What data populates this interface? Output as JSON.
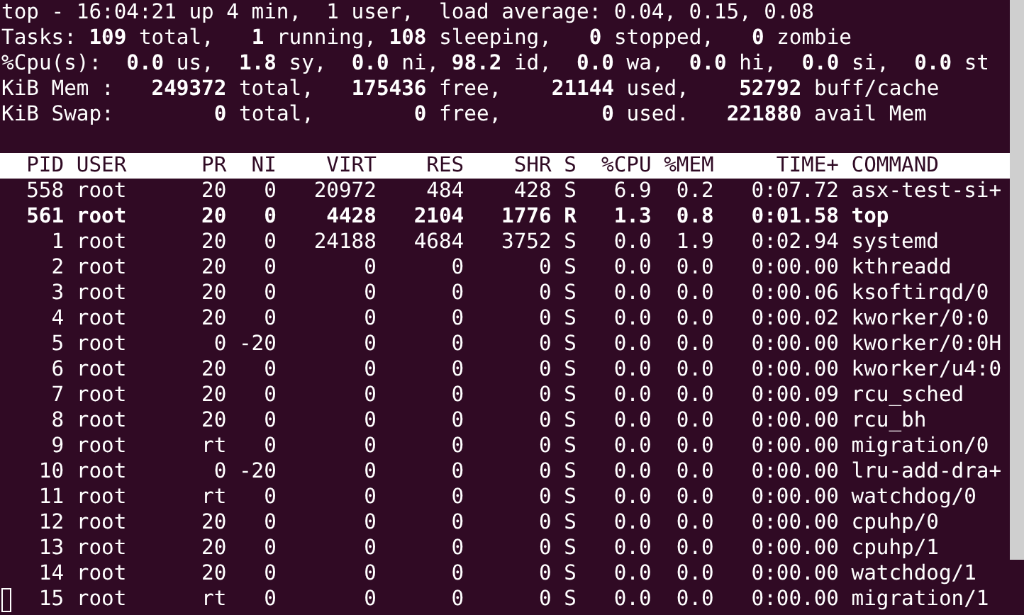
{
  "summary": [
    "top - 16:04:21 up 4 min,  1 user,  load average: 0.04, 0.15, 0.08",
    "Tasks: **109** total,   **1** running, **108** sleeping,   **0** stopped,   **0** zombie",
    "%Cpu(s):  **0.0** us,  **1.8** sy,  **0.0** ni, **98.2** id,  **0.0** wa,  **0.0** hi,  **0.0** si,  **0.0** st",
    "KiB Mem :   **249372** total,   **175436** free,    **21144** used,    **52792** buff/cache",
    "KiB Swap:        **0** total,        **0** free,        **0** used.   **221880** avail Mem"
  ],
  "table": {
    "columns": [
      "PID",
      "USER",
      "PR",
      "NI",
      "VIRT",
      "RES",
      "SHR",
      "S",
      "%CPU",
      "%MEM",
      "TIME+",
      "COMMAND"
    ],
    "rows": [
      {
        "cells": [
          "558",
          "root",
          "20",
          "0",
          "20972",
          "484",
          "428",
          "S",
          "6.9",
          "0.2",
          "0:07.72",
          "asx-test-si+"
        ],
        "highlighted": false
      },
      {
        "cells": [
          "561",
          "root",
          "20",
          "0",
          "4428",
          "2104",
          "1776",
          "R",
          "1.3",
          "0.8",
          "0:01.58",
          "top"
        ],
        "highlighted": true
      },
      {
        "cells": [
          "1",
          "root",
          "20",
          "0",
          "24188",
          "4684",
          "3752",
          "S",
          "0.0",
          "1.9",
          "0:02.94",
          "systemd"
        ],
        "highlighted": false
      },
      {
        "cells": [
          "2",
          "root",
          "20",
          "0",
          "0",
          "0",
          "0",
          "S",
          "0.0",
          "0.0",
          "0:00.00",
          "kthreadd"
        ],
        "highlighted": false
      },
      {
        "cells": [
          "3",
          "root",
          "20",
          "0",
          "0",
          "0",
          "0",
          "S",
          "0.0",
          "0.0",
          "0:00.06",
          "ksoftirqd/0"
        ],
        "highlighted": false
      },
      {
        "cells": [
          "4",
          "root",
          "20",
          "0",
          "0",
          "0",
          "0",
          "S",
          "0.0",
          "0.0",
          "0:00.02",
          "kworker/0:0"
        ],
        "highlighted": false
      },
      {
        "cells": [
          "5",
          "root",
          "0",
          "-20",
          "0",
          "0",
          "0",
          "S",
          "0.0",
          "0.0",
          "0:00.00",
          "kworker/0:0H"
        ],
        "highlighted": false
      },
      {
        "cells": [
          "6",
          "root",
          "20",
          "0",
          "0",
          "0",
          "0",
          "S",
          "0.0",
          "0.0",
          "0:00.00",
          "kworker/u4:0"
        ],
        "highlighted": false
      },
      {
        "cells": [
          "7",
          "root",
          "20",
          "0",
          "0",
          "0",
          "0",
          "S",
          "0.0",
          "0.0",
          "0:00.09",
          "rcu_sched"
        ],
        "highlighted": false
      },
      {
        "cells": [
          "8",
          "root",
          "20",
          "0",
          "0",
          "0",
          "0",
          "S",
          "0.0",
          "0.0",
          "0:00.00",
          "rcu_bh"
        ],
        "highlighted": false
      },
      {
        "cells": [
          "9",
          "root",
          "rt",
          "0",
          "0",
          "0",
          "0",
          "S",
          "0.0",
          "0.0",
          "0:00.00",
          "migration/0"
        ],
        "highlighted": false
      },
      {
        "cells": [
          "10",
          "root",
          "0",
          "-20",
          "0",
          "0",
          "0",
          "S",
          "0.0",
          "0.0",
          "0:00.00",
          "lru-add-dra+"
        ],
        "highlighted": false
      },
      {
        "cells": [
          "11",
          "root",
          "rt",
          "0",
          "0",
          "0",
          "0",
          "S",
          "0.0",
          "0.0",
          "0:00.00",
          "watchdog/0"
        ],
        "highlighted": false
      },
      {
        "cells": [
          "12",
          "root",
          "20",
          "0",
          "0",
          "0",
          "0",
          "S",
          "0.0",
          "0.0",
          "0:00.00",
          "cpuhp/0"
        ],
        "highlighted": false
      },
      {
        "cells": [
          "13",
          "root",
          "20",
          "0",
          "0",
          "0",
          "0",
          "S",
          "0.0",
          "0.0",
          "0:00.00",
          "cpuhp/1"
        ],
        "highlighted": false
      },
      {
        "cells": [
          "14",
          "root",
          "20",
          "0",
          "0",
          "0",
          "0",
          "S",
          "0.0",
          "0.0",
          "0:00.00",
          "watchdog/1"
        ],
        "highlighted": false
      },
      {
        "cells": [
          "15",
          "root",
          "rt",
          "0",
          "0",
          "0",
          "0",
          "S",
          "0.0",
          "0.0",
          "0:00.00",
          "migration/1"
        ],
        "highlighted": false
      }
    ]
  }
}
